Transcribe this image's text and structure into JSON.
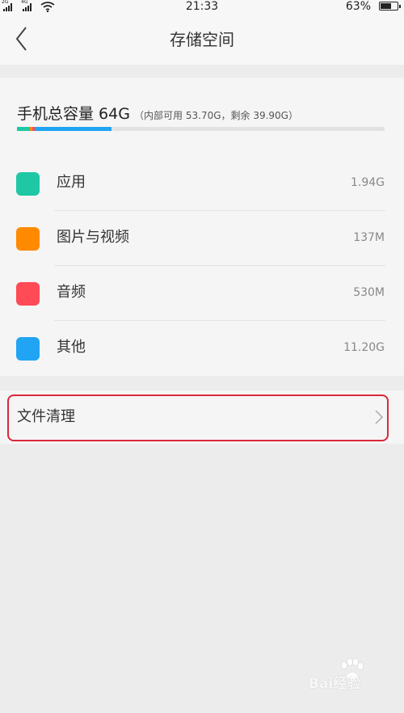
{
  "status_bar": {
    "sim1_type": "2G",
    "sim2_type": "4G",
    "time": "21:33",
    "battery": "63%",
    "battery_level": 0.63
  },
  "header": {
    "title": "存储空间",
    "back_icon": "chevron-left-icon"
  },
  "storage": {
    "capacity_main": "手机总容量 64G",
    "capacity_detail": "（内部可用 53.70G，剩余 39.90G）",
    "usage_segments": [
      {
        "category": "应用",
        "fraction": 0.036,
        "color": "#1ec8a4"
      },
      {
        "category": "图片与视频",
        "fraction": 0.006,
        "color": "#ff8a00"
      },
      {
        "category": "音频",
        "fraction": 0.006,
        "color": "#ff4b55"
      },
      {
        "category": "其他",
        "fraction": 0.21,
        "color": "#20a4f3"
      }
    ],
    "categories": [
      {
        "label": "应用",
        "value": "1.94G",
        "color": "#1ec8a4"
      },
      {
        "label": "图片与视频",
        "value": "137M",
        "color": "#ff8a00"
      },
      {
        "label": "音频",
        "value": "530M",
        "color": "#ff4b55"
      },
      {
        "label": "其他",
        "value": "11.20G",
        "color": "#20a4f3"
      }
    ]
  },
  "file_clean": {
    "label": "文件清理",
    "chevron_icon": "chevron-right-icon",
    "highlight_color": "#d9283a"
  },
  "watermark": {
    "text": "Bai经验",
    "icon": "baidu-paw-icon"
  }
}
